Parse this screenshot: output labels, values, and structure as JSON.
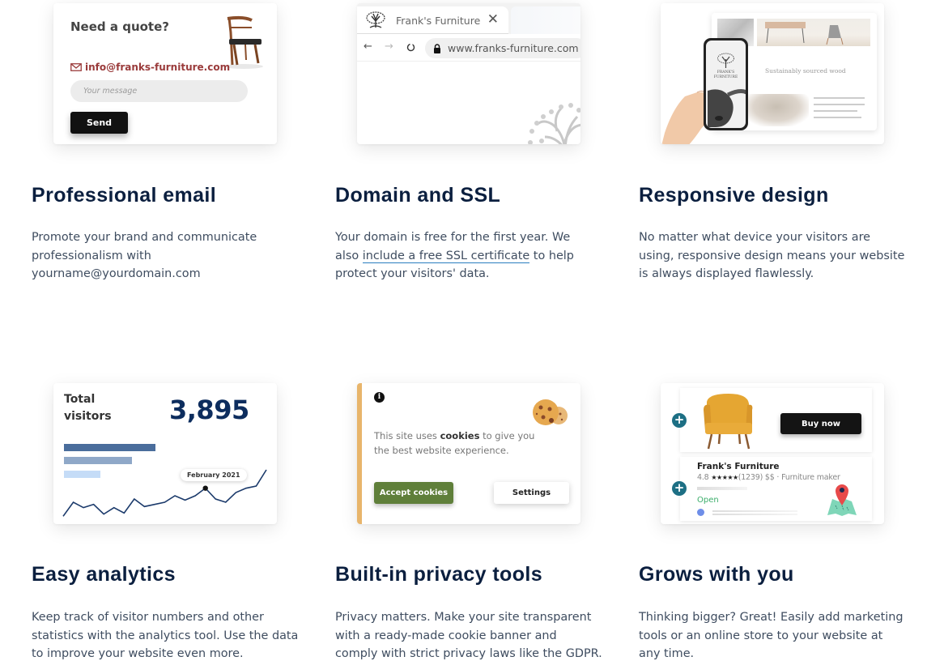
{
  "features": [
    {
      "title": "Professional email",
      "description": "Promote your brand and communicate professionalism with yourname@yourdomain.com",
      "card": {
        "heading": "Need a quote?",
        "email": "info@franks-furniture.com",
        "message_placeholder": "Your message",
        "send_label": "Send"
      }
    },
    {
      "title": "Domain and SSL",
      "description_before": "Your domain is free for the first year. We also ",
      "link_text": "include a free SSL certificate",
      "description_after": " to help protect your visitors' data.",
      "card": {
        "tab_title": "Frank's Furniture",
        "tab_close": "✕",
        "back": "←",
        "forward": "→",
        "url": "www.franks-furniture.com"
      }
    },
    {
      "title": "Responsive design",
      "description": "No matter what device your visitors are using, responsive design means your website is always displayed flawlessly.",
      "card": {
        "caption": "Sustainably sourced wood",
        "phone_brand_line1": "FRANK'S",
        "phone_brand_line2": "FURNITURE"
      }
    },
    {
      "title": "Easy analytics",
      "description": "Keep track of visitor numbers and other statistics with the analytics tool. Use the data to improve your website even more.",
      "card": {
        "label_line1": "Total",
        "label_line2": "visitors",
        "value": "3,895",
        "tooltip": "February 2021",
        "bar_levels": [
          1.0,
          0.74,
          0.4
        ],
        "bar_colors": [
          "#4a6d9c",
          "#8fa8c8",
          "#c5dcf7"
        ],
        "line_color": "#1b3a6b",
        "trend": [
          2,
          15,
          10,
          13,
          4,
          10,
          5,
          18,
          11,
          13,
          15,
          21,
          17,
          21,
          28,
          18,
          15,
          24,
          28,
          30,
          45
        ]
      }
    },
    {
      "title": "Built-in privacy tools",
      "description": "Privacy matters. Make your site transparent with a ready-made cookie banner and comply with strict privacy laws like the GDPR.",
      "card": {
        "info_glyph": "i",
        "text_before": "This site uses ",
        "text_bold": "cookies",
        "text_after": " to give you the best website experience.",
        "accept_label": "Accept cookies",
        "settings_label": "Settings"
      }
    },
    {
      "title": "Grows with you",
      "description": "Thinking bigger? Great! Easily add marketing tools or an online store to your website at any time.",
      "card": {
        "buy_label": "Buy now",
        "plus_glyph": "+",
        "business_name": "Frank's Furniture",
        "rating": "4.8",
        "stars": "★★★★★",
        "review_count": "(1239)",
        "price_category": "$$ · Furniture maker",
        "status": "Open"
      }
    }
  ],
  "colors": {
    "heading": "#0b1f3f",
    "body_text": "#3f4d60",
    "link_underline": "#2a7fbf",
    "email_accent": "#9a3b3b",
    "cookie_stripe": "#e8b56b",
    "accept_button": "#5f7f3a",
    "plus_badge": "#1d6f84",
    "open_status": "#3cae6b"
  }
}
